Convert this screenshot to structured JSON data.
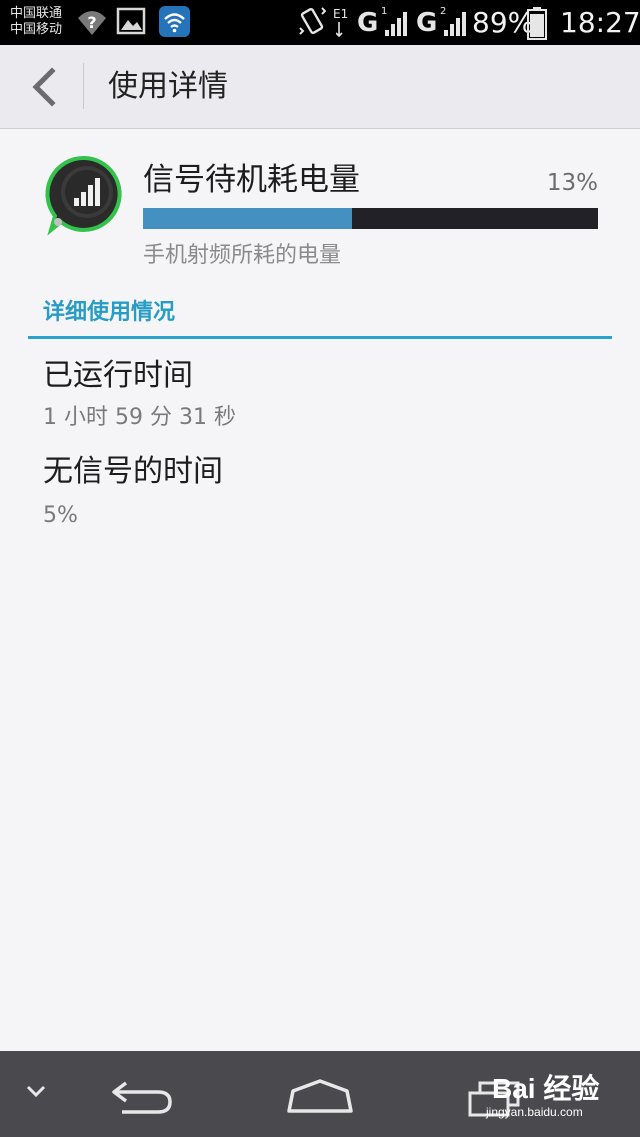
{
  "status_bar": {
    "carrier_1": "中国联通",
    "carrier_2": "中国移动",
    "sim1_network": "G",
    "sim1_slot": "1",
    "sim2_network": "G",
    "sim2_slot": "2",
    "data_indicator": "E1",
    "battery_percent": "89%",
    "time": "18:27"
  },
  "action_bar": {
    "title": "使用详情"
  },
  "app": {
    "name": "信号待机耗电量",
    "percent": "13%",
    "usage_fraction": 0.46,
    "description": "手机射频所耗的电量"
  },
  "details": {
    "section_title": "详细使用情况",
    "items": [
      {
        "label": "已运行时间",
        "value": "1 小时 59 分 31 秒"
      },
      {
        "label": "无信号的时间",
        "value": "5%"
      }
    ]
  },
  "colors": {
    "accent": "#29a3cc",
    "usage_fill": "#4390c1",
    "usage_track": "#212127",
    "nav_bar": "#4a4a4e"
  },
  "watermark": {
    "logo": "Bai 经验",
    "url": "jingyan.baidu.com"
  }
}
